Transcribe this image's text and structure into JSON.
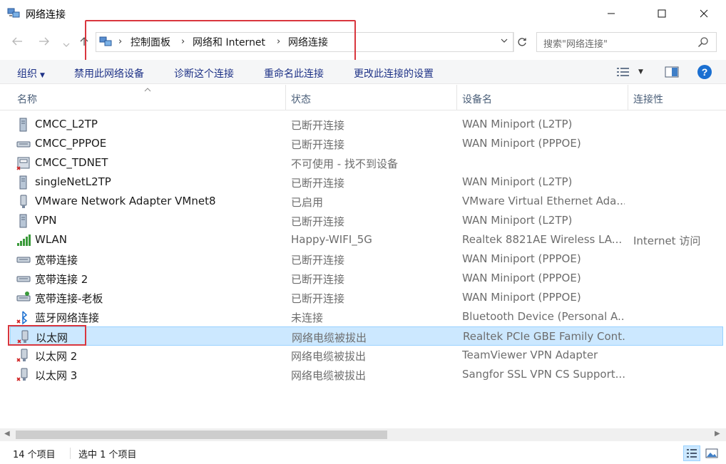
{
  "window": {
    "title": "网络连接"
  },
  "address": {
    "crumbs": [
      "控制面板",
      "网络和 Internet",
      "网络连接"
    ]
  },
  "search": {
    "placeholder": "搜索\"网络连接\""
  },
  "commands": {
    "organize": "组织",
    "disable": "禁用此网络设备",
    "diagnose": "诊断这个连接",
    "rename": "重命名此连接",
    "change": "更改此连接的设置"
  },
  "columns": {
    "name": "名称",
    "status": "状态",
    "device": "设备名",
    "connectivity": "连接性"
  },
  "rows": [
    {
      "name": "CMCC_L2TP",
      "status": "已断开连接",
      "device": "WAN Miniport (L2TP)",
      "conn": "",
      "icon": "vpn-icon"
    },
    {
      "name": "CMCC_PPPOE",
      "status": "已断开连接",
      "device": "WAN Miniport (PPPOE)",
      "conn": "",
      "icon": "broadband-icon"
    },
    {
      "name": "CMCC_TDNET",
      "status": "不可使用 - 找不到设备",
      "device": "",
      "conn": "",
      "icon": "dialup-icon"
    },
    {
      "name": "singleNetL2TP",
      "status": "已断开连接",
      "device": "WAN Miniport (L2TP)",
      "conn": "",
      "icon": "vpn-icon"
    },
    {
      "name": "VMware Network Adapter VMnet8",
      "status": "已启用",
      "device": "VMware Virtual Ethernet Ada...",
      "conn": "",
      "icon": "ethernet-icon"
    },
    {
      "name": "VPN",
      "status": "已断开连接",
      "device": "WAN Miniport (L2TP)",
      "conn": "",
      "icon": "vpn-icon"
    },
    {
      "name": "WLAN",
      "status": "Happy-WIFI_5G",
      "device": "Realtek 8821AE Wireless LA...",
      "conn": "Internet 访问",
      "icon": "wifi-icon"
    },
    {
      "name": "宽带连接",
      "status": "已断开连接",
      "device": "WAN Miniport (PPPOE)",
      "conn": "",
      "icon": "broadband-icon"
    },
    {
      "name": "宽带连接 2",
      "status": "已断开连接",
      "device": "WAN Miniport (PPPOE)",
      "conn": "",
      "icon": "broadband-icon"
    },
    {
      "name": "宽带连接-老板",
      "status": "已断开连接",
      "device": "WAN Miniport (PPPOE)",
      "conn": "",
      "icon": "broadband-icon"
    },
    {
      "name": "蓝牙网络连接",
      "status": "未连接",
      "device": "Bluetooth Device (Personal A...",
      "conn": "",
      "icon": "bluetooth-icon"
    },
    {
      "name": "以太网",
      "status": "网络电缆被拔出",
      "device": "Realtek PCIe GBE Family Cont...",
      "conn": "",
      "icon": "ethernet-x-icon"
    },
    {
      "name": "以太网 2",
      "status": "网络电缆被拔出",
      "device": "TeamViewer VPN Adapter",
      "conn": "",
      "icon": "ethernet-x-icon"
    },
    {
      "name": "以太网 3",
      "status": "网络电缆被拔出",
      "device": "Sangfor SSL VPN CS Support...",
      "conn": "",
      "icon": "ethernet-x-icon"
    }
  ],
  "status_bar": {
    "count": "14 个项目",
    "selected": "选中 1 个项目"
  },
  "colors": {
    "command_text": "#1e3287",
    "selection": "#cce8ff",
    "annotation_red": "#d9363e"
  }
}
